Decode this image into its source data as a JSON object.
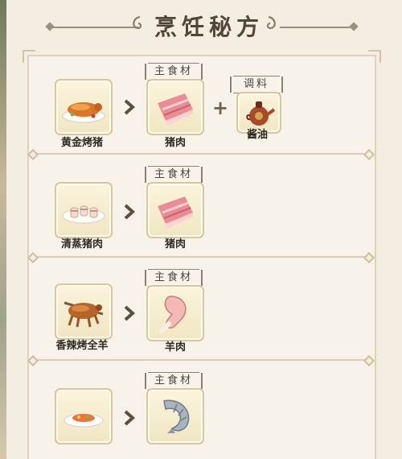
{
  "title": "烹饪秘方",
  "labels": {
    "main_ingredient": "主食材",
    "seasoning": "调料"
  },
  "recipes": [
    {
      "dish": "黄金烤猪",
      "dish_icon": "roast-pig-icon",
      "main": "猪肉",
      "main_icon": "pork-icon",
      "seasoning": "酱油",
      "seasoning_icon": "soy-sauce-icon"
    },
    {
      "dish": "清蒸猪肉",
      "dish_icon": "steamed-pork-icon",
      "main": "猪肉",
      "main_icon": "pork-icon"
    },
    {
      "dish": "香辣烤全羊",
      "dish_icon": "roast-lamb-icon",
      "main": "羊肉",
      "main_icon": "lamb-leg-icon"
    },
    {
      "dish": "",
      "dish_icon": "shrimp-dish-icon",
      "main": "",
      "main_icon": "shrimp-icon"
    }
  ],
  "colors": {
    "background": "#f3eee1",
    "slot": "#f1e6c3",
    "border": "#d9c79c",
    "text": "#2f2a22"
  }
}
